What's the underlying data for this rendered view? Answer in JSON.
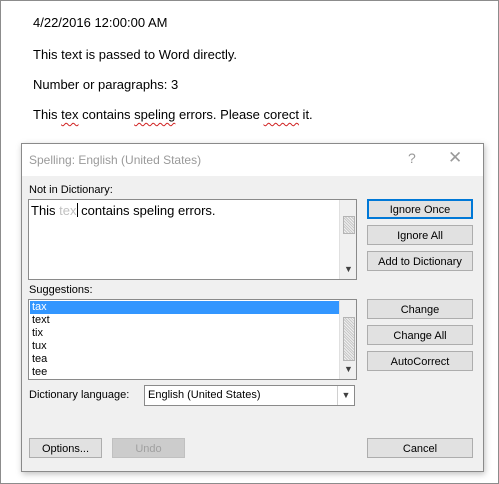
{
  "document": {
    "date_line": "4/22/2016 12:00:00 AM",
    "line_passed": "This text is passed to Word directly.",
    "line_paragraphs": "Number or paragraphs: 3",
    "line_errors_pre": "This ",
    "line_errors_w1": "tex",
    "line_errors_mid1": " contains ",
    "line_errors_w2": "speling",
    "line_errors_mid2": " errors. Please ",
    "line_errors_w3": "corect",
    "line_errors_post": " it."
  },
  "dialog": {
    "title": "Spelling: English (United States)",
    "help_glyph": "?",
    "close_glyph": "✕",
    "not_in_dictionary_label": "Not in Dictionary:",
    "not_in_dictionary_text": {
      "before": "This ",
      "error_word": "tex",
      "after": " contains speling errors."
    },
    "suggestions_label": "Suggestions:",
    "suggestions": [
      "tax",
      "text",
      "tix",
      "tux",
      "tea",
      "tee"
    ],
    "selected_suggestion": "tax",
    "dictionary_language_label": "Dictionary language:",
    "dictionary_language_value": "English (United States)",
    "buttons": {
      "ignore_once": "Ignore Once",
      "ignore_all": "Ignore All",
      "add_to_dictionary": "Add to Dictionary",
      "change": "Change",
      "change_all": "Change All",
      "autocorrect": "AutoCorrect",
      "options": "Options...",
      "undo": "Undo",
      "cancel": "Cancel"
    }
  },
  "colors": {
    "selection": "#3296ff",
    "primary_border": "#0078d7",
    "spell_error": "#d02020"
  },
  "icons": {
    "help": "help-icon",
    "close": "close-icon",
    "scroll_down": "chevron-down-icon",
    "dropdown": "chevron-down-icon"
  }
}
